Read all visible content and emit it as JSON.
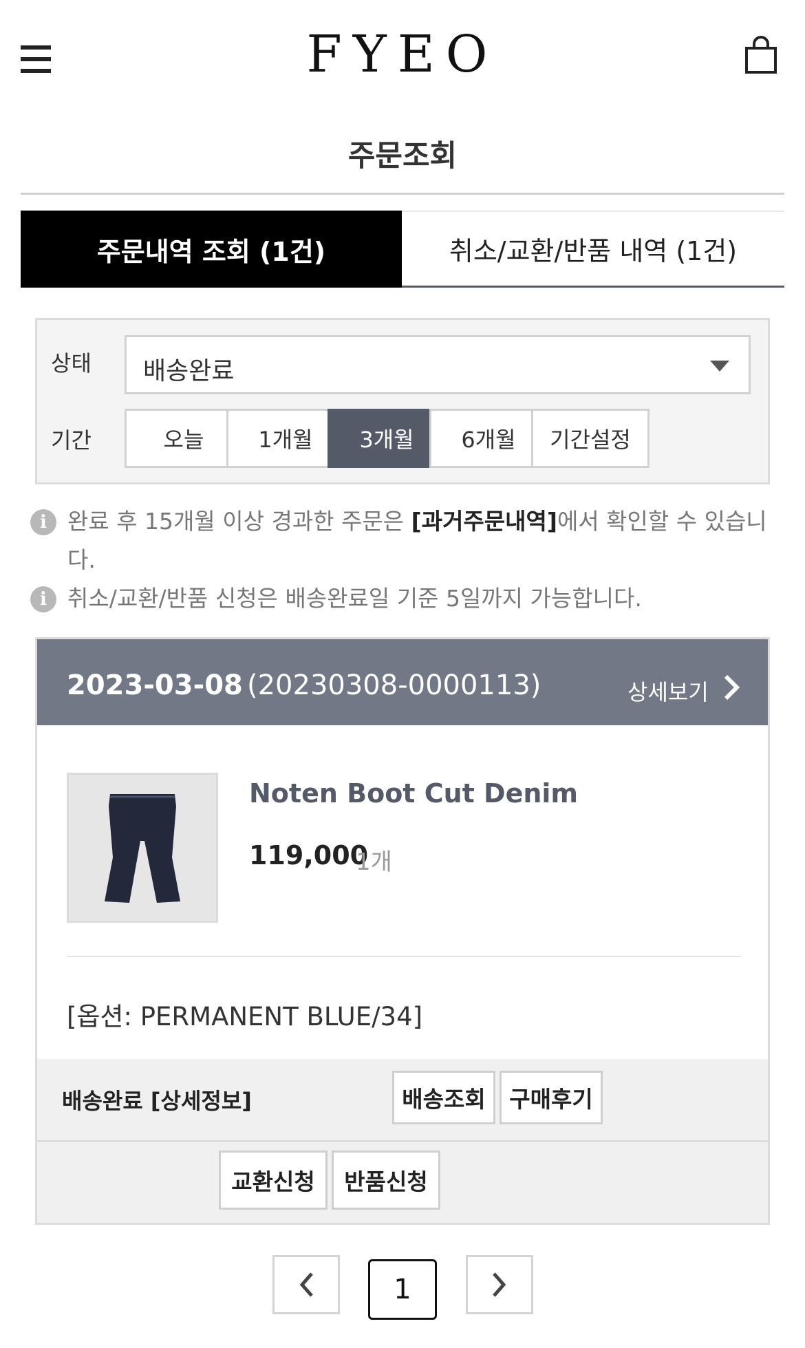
{
  "header": {
    "logo": "FYEO",
    "menu_icon": "hamburger-menu-icon",
    "cart_icon": "shopping-bag-icon"
  },
  "page": {
    "title": "주문조회"
  },
  "tabs": [
    {
      "label": "주문내역 조회 (1건)",
      "active": true
    },
    {
      "label": "취소/교환/반품 내역 (1건)",
      "active": false
    }
  ],
  "filter": {
    "status_label": "상태",
    "status_value": "배송완료",
    "period_label": "기간",
    "periods": [
      "오늘",
      "1개월",
      "3개월",
      "6개월",
      "기간설정"
    ],
    "active_period": "3개월"
  },
  "notices": [
    {
      "before": "완료 후 15개월 이상 경과한 주문은 ",
      "highlight": "[과거주문내역]",
      "after": "에서 확인할 수 있습니다."
    },
    {
      "text": "취소/교환/반품 신청은 배송완료일 기준 5일까지 가능합니다."
    }
  ],
  "order": {
    "date": "2023-03-08",
    "number": "(20230308-0000113)",
    "detail_label": "상세보기",
    "product_name": "Noten Boot Cut Denim",
    "price": "119,000",
    "quantity": "1개",
    "option": "[옵션: PERMANENT BLUE/34]",
    "status": "배송완료 [상세정보]",
    "buttons": {
      "tracking": "배송조회",
      "review": "구매후기",
      "exchange": "교환신청",
      "return": "반품신청"
    }
  },
  "pagination": {
    "current_page": "1"
  },
  "colors": {
    "accent": "#545a68",
    "header_bar": "#727886",
    "active_tab": "#000000"
  }
}
